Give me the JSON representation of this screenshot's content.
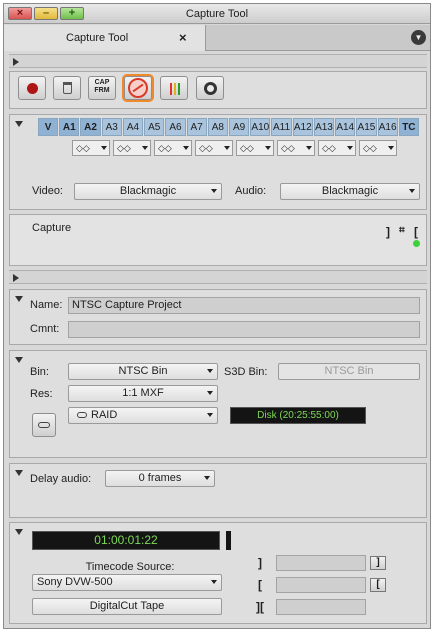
{
  "window": {
    "title": "Capture Tool",
    "controls": {
      "close": "×",
      "minimize": "–",
      "maximize": "+"
    }
  },
  "tab": {
    "label": "Capture Tool",
    "close": "×"
  },
  "toolbar": {
    "cap_button_label": "CAP\nFRM"
  },
  "tracks": {
    "items": [
      "V",
      "A1",
      "A2",
      "A3",
      "A4",
      "A5",
      "A6",
      "A7",
      "A8",
      "A9",
      "A10",
      "A11",
      "A12",
      "A13",
      "A14",
      "A15",
      "A16",
      "TC"
    ],
    "monitor_value": "◇◇"
  },
  "io": {
    "video_label": "Video:",
    "video_value": "Blackmagic",
    "audio_label": "Audio:",
    "audio_value": "Blackmagic"
  },
  "capture_box": {
    "label": "Capture",
    "status_color": "#3ad13a"
  },
  "project": {
    "name_label": "Name:",
    "name_value": "NTSC Capture Project",
    "comment_label": "Cmnt:",
    "comment_value": ""
  },
  "bins": {
    "bin_label": "Bin:",
    "bin_value": "NTSC Bin",
    "s3d_label": "S3D Bin:",
    "s3d_value": "NTSC Bin",
    "res_label": "Res:",
    "res_value": "1:1 MXF",
    "drive_value": "RAID",
    "disk_readout": "Disk (20:25:55:00)"
  },
  "delay": {
    "label": "Delay audio:",
    "value": "0 frames"
  },
  "deck": {
    "timecode": "01:00:01:22",
    "tc_source_label": "Timecode Source:",
    "deck_value": "Sony DVW-500",
    "digitalcut_label": "DigitalCut Tape"
  }
}
